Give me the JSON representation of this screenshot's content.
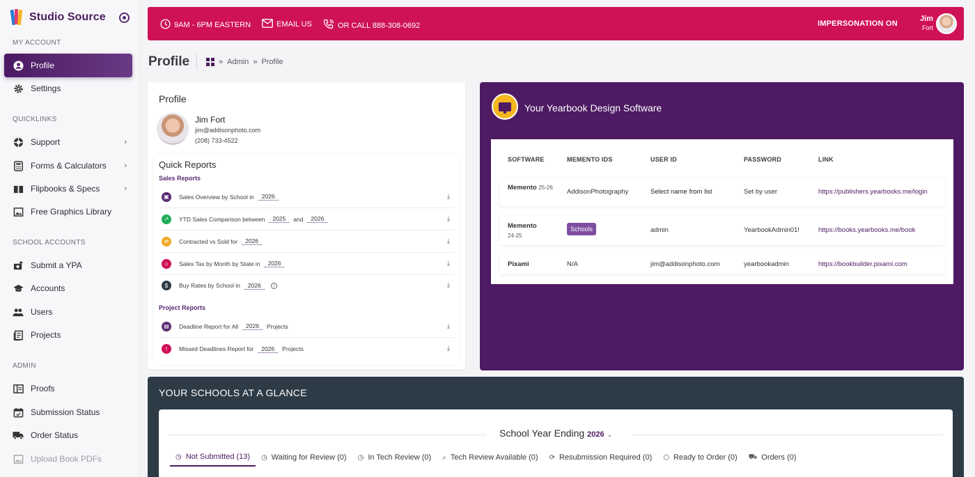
{
  "brand": {
    "name": "Studio Source"
  },
  "sidebar": {
    "sections": [
      {
        "label": "MY ACCOUNT"
      },
      {
        "label": "QUICKLINKS"
      },
      {
        "label": "SCHOOL ACCOUNTS"
      },
      {
        "label": "ADMIN"
      }
    ],
    "items": [
      {
        "label": "Profile",
        "icon": "user-circle-icon"
      },
      {
        "label": "Settings",
        "icon": "gear-icon"
      },
      {
        "label": "Support",
        "icon": "lifebuoy-icon"
      },
      {
        "label": "Forms & Calculators",
        "icon": "calculator-icon"
      },
      {
        "label": "Flipbooks & Specs",
        "icon": "book-icon"
      },
      {
        "label": "Free Graphics Library",
        "icon": "image-icon"
      },
      {
        "label": "Submit a YPA",
        "icon": "camera-plus-icon"
      },
      {
        "label": "Accounts",
        "icon": "graduation-cap-icon"
      },
      {
        "label": "Users",
        "icon": "users-icon"
      },
      {
        "label": "Projects",
        "icon": "document-icon"
      },
      {
        "label": "Proofs",
        "icon": "proof-icon"
      },
      {
        "label": "Submission Status",
        "icon": "calendar-icon"
      },
      {
        "label": "Order Status",
        "icon": "truck-icon"
      },
      {
        "label": "Upload Book PDFs",
        "icon": "upload-icon"
      }
    ]
  },
  "topbar": {
    "hours": "9AM - 6PM EASTERN",
    "email": "EMAIL US",
    "phone": "OR CALL 888-308-0692",
    "impersonation": "IMPERSONATION ON",
    "user_first": "Jim",
    "user_last": "Fort",
    "color": "#cf1158"
  },
  "page": {
    "title": "Profile",
    "breadcrumb": [
      "Admin",
      "Profile"
    ]
  },
  "profile": {
    "title": "Profile",
    "name": "Jim Fort",
    "email": "jim@addisonphoto.com",
    "phone": "(208) 733-4522"
  },
  "quick_reports": {
    "title": "Quick Reports",
    "sales_label": "Sales Reports",
    "project_label": "Project Reports",
    "sales": [
      {
        "text": "Sales Overview by School in",
        "year": "2026"
      },
      {
        "text": "YTD Sales Comparison between",
        "year": "2025",
        "and": "and",
        "year2": "2026"
      },
      {
        "text": "Contracted vs Sold for",
        "year": "2026"
      },
      {
        "text": "Sales Tax by Month by State in",
        "year": "2026"
      },
      {
        "text": "Buy Rates by School in",
        "year": "2026"
      }
    ],
    "projects": [
      {
        "text": "Deadline Report for All",
        "year": "2026",
        "suffix": "Projects"
      },
      {
        "text": "Missed Deadlines Report for",
        "year": "2026",
        "suffix": "Projects"
      }
    ]
  },
  "software": {
    "title": "Your Yearbook Design Software",
    "headers": [
      "SOFTWARE",
      "MEMENTO IDS",
      "USER ID",
      "PASSWORD",
      "LINK"
    ],
    "rows": [
      {
        "name": "Memento",
        "year": "25-26",
        "ids": "AddisonPhotography",
        "user": "Select name from list",
        "password": "Set by user",
        "link": "https://publishers.yearbooks.me/login"
      },
      {
        "name": "Memento",
        "year": "24-25",
        "ids": "Schools",
        "user": "admin",
        "password": "YearbookAdmin01!",
        "link": "https://books.yearbooks.me/book"
      },
      {
        "name": "Pixami",
        "year": "",
        "ids": "N/A",
        "user": "jim@addisonphoto.com",
        "password": "yearbookadmin",
        "link": "https://bookbuilder.pixami.com"
      }
    ],
    "color": "#4d1a63"
  },
  "glance": {
    "title": "YOUR SCHOOLS AT A GLANCE",
    "year_label": "School Year Ending",
    "year": "2026",
    "tabs": [
      {
        "label": "Not Submitted (13)",
        "icon": "clock-icon"
      },
      {
        "label": "Waiting for Review (0)",
        "icon": "clock-icon"
      },
      {
        "label": "In Tech Review (0)",
        "icon": "clock-icon"
      },
      {
        "label": "Tech Review Available (0)",
        "icon": "search-icon"
      },
      {
        "label": "Resubmission Required (0)",
        "icon": "refresh-icon"
      },
      {
        "label": "Ready to Order (0)",
        "icon": "box-icon"
      },
      {
        "label": "Orders (0)",
        "icon": "truck-icon"
      }
    ]
  }
}
